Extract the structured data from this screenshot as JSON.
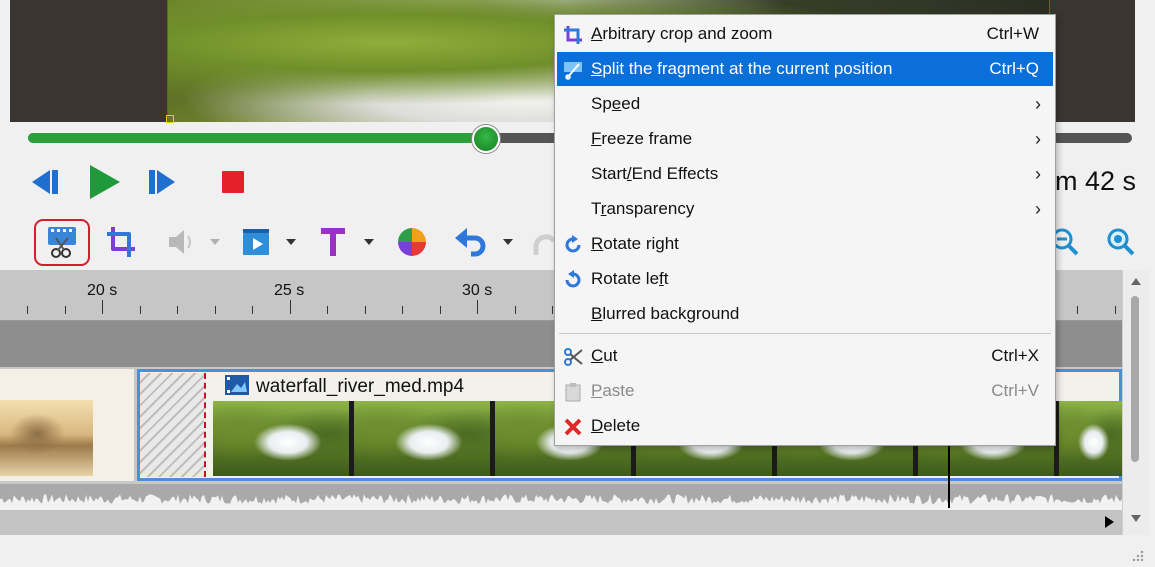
{
  "playback": {
    "time_display": "m 42 s",
    "progress": 0.415
  },
  "timeline": {
    "ruler_labels": [
      "20 s",
      "25 s",
      "30 s"
    ],
    "clip_name": "waterfall_river_med.mp4"
  },
  "context_menu": {
    "items": [
      {
        "label": "Arbitrary crop and zoom",
        "mnemonic_index": 0,
        "shortcut": "Ctrl+W",
        "icon": "crop-icon"
      },
      {
        "label": "Split the fragment at the current position",
        "mnemonic_index": 0,
        "shortcut": "Ctrl+Q",
        "icon": "split-icon",
        "highlighted": true
      },
      {
        "label": "Speed",
        "mnemonic_index": 2,
        "submenu": true
      },
      {
        "label": "Freeze frame",
        "mnemonic_index": 0,
        "submenu": true
      },
      {
        "label": "Start/End Effects",
        "mnemonic_index": 5,
        "submenu": true
      },
      {
        "label": "Transparency",
        "mnemonic_index": 1,
        "submenu": true
      },
      {
        "label": "Rotate right",
        "mnemonic_index": 0,
        "icon": "rotate-right-icon"
      },
      {
        "label": "Rotate left",
        "mnemonic_index": 9,
        "icon": "rotate-left-icon"
      },
      {
        "label": "Blurred background",
        "mnemonic_index": 0
      },
      {
        "label": "Cut",
        "mnemonic_index": 0,
        "shortcut": "Ctrl+X",
        "icon": "scissors-icon"
      },
      {
        "label": "Paste",
        "mnemonic_index": 0,
        "shortcut": "Ctrl+V",
        "icon": "paste-icon",
        "disabled": true
      },
      {
        "label": "Delete",
        "mnemonic_index": 0,
        "icon": "delete-icon"
      }
    ]
  },
  "colors": {
    "accent_green": "#2e9e3a",
    "playback_blue": "#1e6fd0",
    "stop_red": "#e5202a",
    "menu_highlight": "#0a6fd8",
    "selection_outline": "#d21f2b",
    "clip_border": "#4a90d9"
  }
}
